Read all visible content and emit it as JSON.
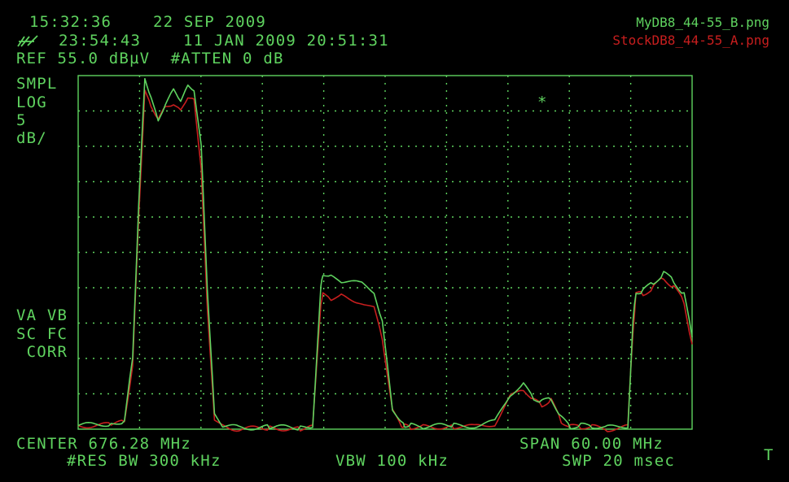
{
  "header": {
    "time1": "15:32:36",
    "date1": "22 SEP 2009",
    "time2": "23:54:43",
    "date2": "11 JAN 2009 20:51:31",
    "ref_line": "REF 55.0 dBµV  #ATTEN 0 dB"
  },
  "left_labels": {
    "mode": "SMPL",
    "scale": "LOG",
    "per_div": "5",
    "unit": "dB/",
    "va_vb": "VA VB",
    "sc_fc": "SC FC",
    "corr": " CORR"
  },
  "footer": {
    "center": "CENTER 676.28 MHz",
    "span": "SPAN 60.00 MHz",
    "res_bw": "#RES BW 300 kHz",
    "vbw": "VBW 100 kHz",
    "swp": "SWP 20 msec",
    "corner": "T"
  },
  "marker_symbol": "*",
  "legend": [
    {
      "label": "MyDB8_44-55_B.png",
      "color": "#5fd35f"
    },
    {
      "label": "StockDB8_44-55_A.png",
      "color": "#c81e1e"
    }
  ],
  "colors": {
    "grid": "#5fd35f",
    "trace_b": "#5fd35f",
    "trace_a": "#c81e1e",
    "background": "#000000"
  },
  "chart_data": {
    "type": "line",
    "x_unit": "MHz",
    "y_unit": "dBµV",
    "xlim": [
      646.28,
      706.28
    ],
    "ylim": [
      5.0,
      55.0
    ],
    "grid": true,
    "series": [
      {
        "name": "MyDB8_44-55_B.png",
        "x": [
          646.28,
          649.5,
          650.8,
          651.6,
          652.2,
          652.8,
          653.4,
          654.1,
          654.8,
          655.6,
          656.3,
          657.0,
          657.6,
          658.3,
          658.9,
          659.6,
          660.4,
          662.0,
          665.0,
          668.0,
          669.2,
          670.0,
          670.2,
          671.0,
          672.0,
          674.0,
          675.2,
          676.0,
          677.0,
          677.9,
          678.2,
          678.8,
          680.0,
          683.0,
          685.0,
          687.0,
          688.5,
          689.8,
          690.8,
          691.6,
          692.5,
          693.5,
          694.4,
          695.4,
          696.5,
          698.0,
          700.0,
          700.5,
          700.8,
          701.5,
          702.5,
          703.5,
          704.5,
          705.5,
          706.28
        ],
        "y": [
          5.5,
          5.8,
          6.2,
          15.0,
          37.0,
          54.5,
          52.0,
          48.5,
          51.0,
          53.0,
          51.5,
          53.5,
          53.0,
          45.0,
          25.0,
          7.0,
          5.5,
          5.2,
          5.3,
          5.2,
          5.5,
          25.0,
          27.0,
          26.5,
          26.0,
          25.5,
          24.5,
          20.0,
          8.0,
          5.7,
          5.6,
          5.5,
          5.4,
          5.5,
          5.5,
          6.0,
          10.0,
          11.2,
          9.5,
          8.8,
          9.5,
          6.5,
          5.4,
          5.5,
          5.5,
          5.2,
          5.5,
          20.0,
          24.5,
          24.5,
          25.8,
          27.0,
          26.0,
          24.0,
          18.0
        ],
        "note_x2": [
          699.5,
          700.8,
          701.2,
          702.0,
          703.0,
          703.5,
          704.0,
          704.5,
          704.8,
          705.2,
          705.6,
          706.28
        ],
        "note_y2": [
          20.0,
          24.5,
          25.0,
          25.5,
          26.5,
          26.5,
          27.0,
          26.5,
          24.0,
          18.0,
          7.0,
          5.8
        ]
      },
      {
        "name": "StockDB8_44-55_A.png",
        "x": [
          646.28,
          649.5,
          650.8,
          651.6,
          652.2,
          652.8,
          653.4,
          654.1,
          654.8,
          655.6,
          656.3,
          657.0,
          657.6,
          658.3,
          658.9,
          659.6,
          660.4,
          662.0,
          665.0,
          668.0,
          669.2,
          670.0,
          670.2,
          671.0,
          672.0,
          674.0,
          675.2,
          676.0,
          677.0,
          677.9,
          678.2,
          678.8,
          680.0,
          683.0,
          685.0,
          687.0,
          688.5,
          689.8,
          690.8,
          691.6,
          692.5,
          693.5,
          694.4,
          695.4,
          696.5,
          698.0,
          700.0,
          700.5,
          700.8,
          701.5,
          702.5,
          703.5,
          704.5,
          705.5,
          706.28
        ],
        "y": [
          5.5,
          5.6,
          6.0,
          14.0,
          35.0,
          53.0,
          50.5,
          49.0,
          50.5,
          51.0,
          50.0,
          52.0,
          51.5,
          42.0,
          22.0,
          6.5,
          5.4,
          5.0,
          5.2,
          5.0,
          5.3,
          23.0,
          24.0,
          23.5,
          23.8,
          23.0,
          22.0,
          18.0,
          7.5,
          5.6,
          5.4,
          5.3,
          5.3,
          5.4,
          5.3,
          5.8,
          9.5,
          10.8,
          9.0,
          8.5,
          9.0,
          6.2,
          5.3,
          5.4,
          5.3,
          5.0,
          5.3,
          19.0,
          24.0,
          24.2,
          25.0,
          26.5,
          25.0,
          23.0,
          17.0
        ]
      }
    ]
  }
}
